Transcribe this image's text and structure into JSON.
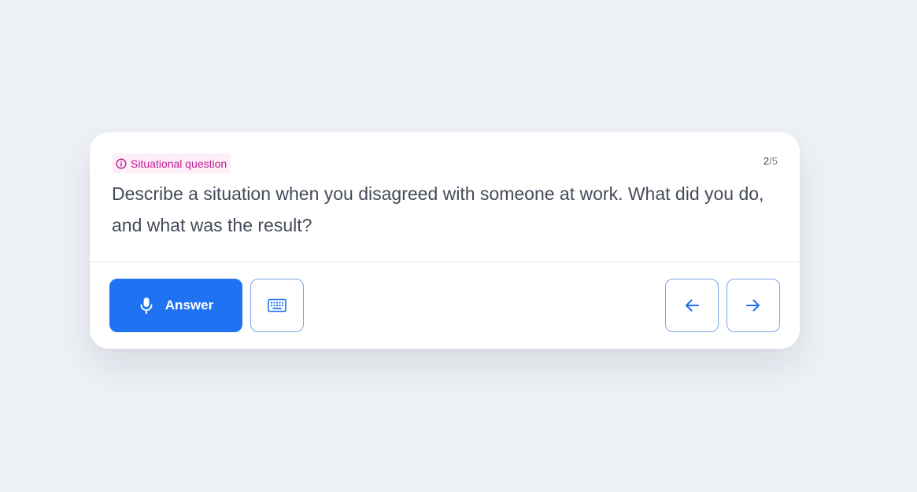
{
  "question_card": {
    "badge_label": "Situational question",
    "badge_icon": "info-circle-icon",
    "counter_current": "2",
    "counter_separator": "/",
    "counter_total": "5",
    "question_text": "Describe a situation when you disagreed with someone at work. What did you do, and what was the result?"
  },
  "actions": {
    "answer_label": "Answer",
    "answer_icon": "microphone-icon",
    "keyboard_icon": "keyboard-icon",
    "prev_icon": "arrow-left-icon",
    "next_icon": "arrow-right-icon"
  },
  "colors": {
    "background": "#edf0f5",
    "card": "#ffffff",
    "primary": "#1f72f2",
    "badge_text": "#c01c94",
    "badge_bg": "#fdeef8",
    "question_text": "#454b5a",
    "outline_border": "#7ea6e3"
  }
}
